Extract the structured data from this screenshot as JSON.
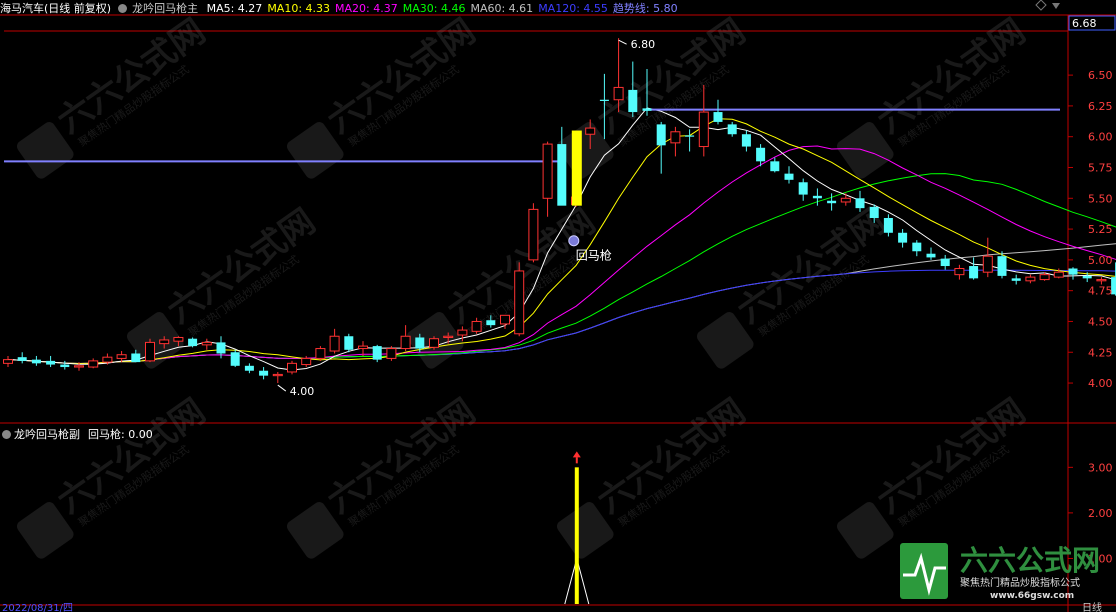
{
  "header": {
    "stock": "海马汽车(日线 前复权)",
    "indicator": "龙吟回马枪主",
    "ma": [
      {
        "label": "MA5: 4.27",
        "color": "#ffffff"
      },
      {
        "label": "MA10: 4.33",
        "color": "#ffff00"
      },
      {
        "label": "MA20: 4.37",
        "color": "#ff00ff"
      },
      {
        "label": "MA30: 4.46",
        "color": "#00ff00"
      },
      {
        "label": "MA60: 4.61",
        "color": "#c0c0c0"
      },
      {
        "label": "MA120: 4.55",
        "color": "#3d3dff"
      },
      {
        "label": "趋势线: 5.80",
        "color": "#8080ff"
      }
    ]
  },
  "sub_header": {
    "title": "龙吟回马枪副",
    "value": "回马枪: 0.00"
  },
  "annotations": {
    "high": "6.80",
    "low": "4.00",
    "signal": "回马枪"
  },
  "right_box": "6.68",
  "date_label": "2022/08/31/四",
  "period_label": "日线",
  "watermark_big": "六六公式网",
  "watermark_small": "聚焦热门精品炒股指标公式",
  "watermark_url": "www.66gsw.com",
  "colors": {
    "up": "#ff3232",
    "down": "#54fcfc",
    "trend": "#8080ff",
    "signal": "#ffff00"
  },
  "chart_data": [
    {
      "type": "candlestick",
      "ylim": [
        3.7,
        6.85
      ],
      "yticks": [
        "6.50",
        "6.25",
        "6.00",
        "5.75",
        "5.50",
        "5.25",
        "5.00",
        "4.75",
        "4.50",
        "4.25",
        "4.00"
      ],
      "candles": [
        [
          4.16,
          4.22,
          4.13,
          4.19
        ],
        [
          4.21,
          4.25,
          4.16,
          4.18
        ],
        [
          4.19,
          4.22,
          4.14,
          4.16
        ],
        [
          4.18,
          4.22,
          4.13,
          4.15
        ],
        [
          4.15,
          4.18,
          4.11,
          4.13
        ],
        [
          4.13,
          4.17,
          4.1,
          4.14
        ],
        [
          4.13,
          4.2,
          4.12,
          4.18
        ],
        [
          4.17,
          4.24,
          4.15,
          4.21
        ],
        [
          4.2,
          4.26,
          4.17,
          4.23
        ],
        [
          4.24,
          4.27,
          4.17,
          4.17
        ],
        [
          4.18,
          4.36,
          4.17,
          4.33
        ],
        [
          4.32,
          4.38,
          4.28,
          4.35
        ],
        [
          4.34,
          4.38,
          4.3,
          4.37
        ],
        [
          4.36,
          4.37,
          4.29,
          4.3
        ],
        [
          4.31,
          4.36,
          4.27,
          4.33
        ],
        [
          4.33,
          4.38,
          4.2,
          4.24
        ],
        [
          4.25,
          4.27,
          4.13,
          4.14
        ],
        [
          4.14,
          4.16,
          4.08,
          4.1
        ],
        [
          4.1,
          4.13,
          4.03,
          4.06
        ],
        [
          4.06,
          4.09,
          4.0,
          4.07
        ],
        [
          4.09,
          4.18,
          4.07,
          4.16
        ],
        [
          4.15,
          4.22,
          4.13,
          4.2
        ],
        [
          4.2,
          4.3,
          4.18,
          4.28
        ],
        [
          4.26,
          4.44,
          4.24,
          4.38
        ],
        [
          4.38,
          4.4,
          4.25,
          4.27
        ],
        [
          4.28,
          4.34,
          4.22,
          4.3
        ],
        [
          4.3,
          4.31,
          4.17,
          4.19
        ],
        [
          4.2,
          4.3,
          4.18,
          4.28
        ],
        [
          4.28,
          4.47,
          4.26,
          4.38
        ],
        [
          4.37,
          4.4,
          4.25,
          4.28
        ],
        [
          4.29,
          4.38,
          4.27,
          4.36
        ],
        [
          4.37,
          4.41,
          4.32,
          4.38
        ],
        [
          4.39,
          4.46,
          4.34,
          4.43
        ],
        [
          4.42,
          4.53,
          4.4,
          4.5
        ],
        [
          4.51,
          4.55,
          4.45,
          4.47
        ],
        [
          4.48,
          4.55,
          4.44,
          4.55
        ],
        [
          4.4,
          4.98,
          4.38,
          4.91
        ],
        [
          5.0,
          5.46,
          4.98,
          5.41
        ],
        [
          5.5,
          5.96,
          5.35,
          5.94
        ],
        [
          5.94,
          6.08,
          5.48,
          5.44
        ],
        [
          5.45,
          6.0,
          5.43,
          5.51
        ],
        [
          6.02,
          6.14,
          5.9,
          6.07
        ],
        [
          6.3,
          6.51,
          5.98,
          6.29
        ],
        [
          6.3,
          6.8,
          6.2,
          6.4
        ],
        [
          6.38,
          6.61,
          6.16,
          6.2
        ],
        [
          6.23,
          6.55,
          6.17,
          6.21
        ],
        [
          6.1,
          6.12,
          5.7,
          5.93
        ],
        [
          5.95,
          6.08,
          5.84,
          6.04
        ],
        [
          6.01,
          6.06,
          5.88,
          6.0
        ],
        [
          5.92,
          6.42,
          5.84,
          6.2
        ],
        [
          6.2,
          6.3,
          6.1,
          6.12
        ],
        [
          6.1,
          6.12,
          6.0,
          6.02
        ],
        [
          6.02,
          6.05,
          5.88,
          5.92
        ],
        [
          5.91,
          5.94,
          5.76,
          5.8
        ],
        [
          5.8,
          5.83,
          5.71,
          5.72
        ],
        [
          5.7,
          5.76,
          5.62,
          5.65
        ],
        [
          5.63,
          5.66,
          5.48,
          5.53
        ],
        [
          5.52,
          5.58,
          5.44,
          5.5
        ],
        [
          5.48,
          5.54,
          5.4,
          5.46
        ],
        [
          5.47,
          5.54,
          5.44,
          5.5
        ],
        [
          5.5,
          5.56,
          5.39,
          5.42
        ],
        [
          5.43,
          5.45,
          5.3,
          5.34
        ],
        [
          5.34,
          5.37,
          5.19,
          5.22
        ],
        [
          5.22,
          5.25,
          5.1,
          5.14
        ],
        [
          5.14,
          5.16,
          5.03,
          5.07
        ],
        [
          5.05,
          5.1,
          5.0,
          5.02
        ],
        [
          5.01,
          5.04,
          4.92,
          4.95
        ],
        [
          4.88,
          4.96,
          4.84,
          4.93
        ],
        [
          4.95,
          5.02,
          4.84,
          4.85
        ],
        [
          4.9,
          5.18,
          4.86,
          5.03
        ],
        [
          5.03,
          5.07,
          4.85,
          4.87
        ],
        [
          4.85,
          4.88,
          4.8,
          4.83
        ],
        [
          4.83,
          4.88,
          4.81,
          4.86
        ],
        [
          4.84,
          4.9,
          4.83,
          4.88
        ],
        [
          4.86,
          4.93,
          4.85,
          4.9
        ],
        [
          4.93,
          4.94,
          4.84,
          4.88
        ],
        [
          4.87,
          4.9,
          4.82,
          4.85
        ],
        [
          4.83,
          4.86,
          4.8,
          4.84
        ],
        [
          4.86,
          4.98,
          4.71,
          4.72
        ],
        [
          4.72,
          4.74,
          4.65,
          4.67
        ],
        [
          4.65,
          4.69,
          4.62,
          4.67
        ],
        [
          4.64,
          4.66,
          4.6,
          4.61
        ],
        [
          4.6,
          4.67,
          4.58,
          4.65
        ],
        [
          4.66,
          4.68,
          4.62,
          4.64
        ],
        [
          4.62,
          4.63,
          4.55,
          4.58
        ],
        [
          4.55,
          4.58,
          4.46,
          4.57
        ]
      ],
      "trend_line_segments": [
        {
          "from_index": 0,
          "to_index": 39,
          "value": 5.8
        },
        {
          "from_index": 45,
          "to_index": 86,
          "value": 6.22
        }
      ],
      "signal_index": 39,
      "signal_bar": [
        5.44,
        6.05
      ]
    },
    {
      "type": "bar",
      "name": "回马枪",
      "ylim": [
        0,
        3.6
      ],
      "yticks": [
        "3.00",
        "2.00",
        "1.00"
      ],
      "x_index": 39,
      "value": 3.0
    }
  ]
}
